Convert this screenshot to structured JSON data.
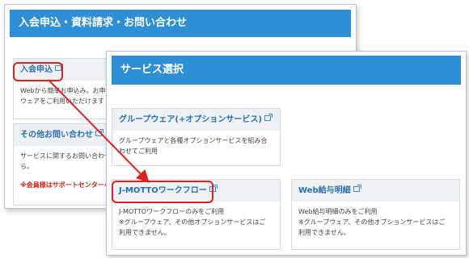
{
  "back_panel": {
    "header": "入会申込・資料請求・お問い合わせ",
    "card1": {
      "title": "入会申込",
      "body_line1": "Webから簡単お申込み。お申",
      "body_line2": "ウェアをご利用いただけます"
    },
    "card2": {
      "title": "その他お問い合わせ",
      "body_line1": "サービスに関するお問い合わせ",
      "body_line2": "ら。",
      "note": "※会員様はサポートセンターへ"
    }
  },
  "front_panel": {
    "header": "サービス選択",
    "groupware": {
      "title": "グループウェア(+オプションサービス)",
      "body_line1": "グループウェアと各種オプションサービスを組み合",
      "body_line2": "わせてご利用"
    },
    "workflow": {
      "title": "J-MOTTOワークフロー",
      "body_line1": "J-MOTTOワークフローのみをご利用",
      "body_line2": "※グループウェア、その他オプションサービスはご",
      "body_line3": "利用できません。"
    },
    "payslip": {
      "title": "Web給与明細",
      "body_line1": "Web給与明細のみをご利用",
      "body_line2": "※グループウェア、その他オプションサービスはご",
      "body_line3": "利用できません。"
    }
  },
  "colors": {
    "header_bg": "#2e8fd6",
    "highlight": "#e0221d",
    "card_title": "#2a6fb0"
  }
}
